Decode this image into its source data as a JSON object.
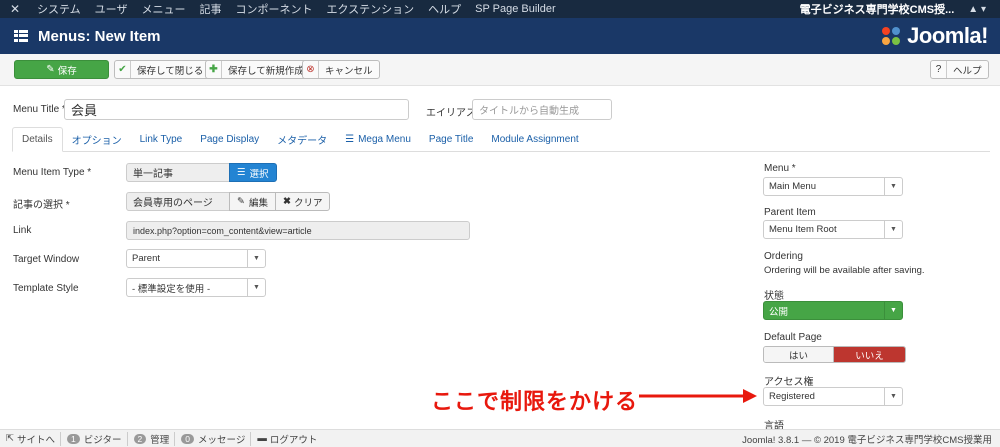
{
  "topbar": {
    "menu": [
      "システム",
      "ユーザ",
      "メニュー",
      "記事",
      "コンポーネント",
      "エクステンション",
      "ヘルプ",
      "SP Page Builder"
    ],
    "site_name": "電子ビジネス専門学校CMS授...",
    "user_icon": "user-icon"
  },
  "header": {
    "title": "Menus: New Item",
    "brand": "Joomla!"
  },
  "toolbar": {
    "save": "保存",
    "save_close": "保存して閉じる",
    "save_new": "保存して新規作成",
    "cancel": "キャンセル",
    "help": "ヘルプ"
  },
  "form": {
    "menu_title_label": "Menu Title *",
    "menu_title_value": "会員",
    "alias_label": "エイリアス",
    "alias_placeholder": "タイトルから自動生成"
  },
  "tabs": [
    "Details",
    "オプション",
    "Link Type",
    "Page Display",
    "メタデータ",
    "Mega Menu",
    "Page Title",
    "Module Assignment"
  ],
  "details": {
    "item_type_label": "Menu Item Type *",
    "item_type_value": "単一記事",
    "select_button": "選択",
    "article_label": "記事の選択 *",
    "article_value": "会員専用のページ",
    "edit_button": "編集",
    "clear_button": "クリア",
    "link_label": "Link",
    "link_value": "index.php?option=com_content&view=article",
    "target_label": "Target Window",
    "target_value": "Parent",
    "template_label": "Template Style",
    "template_value": "- 標準設定を使用 -"
  },
  "sidebar": {
    "menu_label": "Menu *",
    "menu_value": "Main Menu",
    "parent_label": "Parent Item",
    "parent_value": "Menu Item Root",
    "ordering_label": "Ordering",
    "ordering_text": "Ordering will be available after saving.",
    "status_label": "状態",
    "status_value": "公開",
    "default_label": "Default Page",
    "default_yes": "はい",
    "default_no": "いいえ",
    "access_label": "アクセス権",
    "access_value": "Registered",
    "language_label": "言語"
  },
  "annotation": "ここで制限をかける",
  "statusbar": {
    "site": "サイトへ",
    "visitors_count": "1",
    "visitors": "ビジター",
    "admin_count": "2",
    "admin": "管理",
    "messages_count": "0",
    "messages": "メッセージ",
    "logout": "ログアウト",
    "copyright": "Joomla! 3.8.1 — © 2019 電子ビジネス専門学校CMS授業用"
  },
  "colors": {
    "topbar": "#182a40",
    "header": "#1a3867",
    "save_green": "#46a546",
    "select_blue": "#2384d3",
    "no_red": "#bd362f",
    "annotation_red": "#e8180d"
  }
}
